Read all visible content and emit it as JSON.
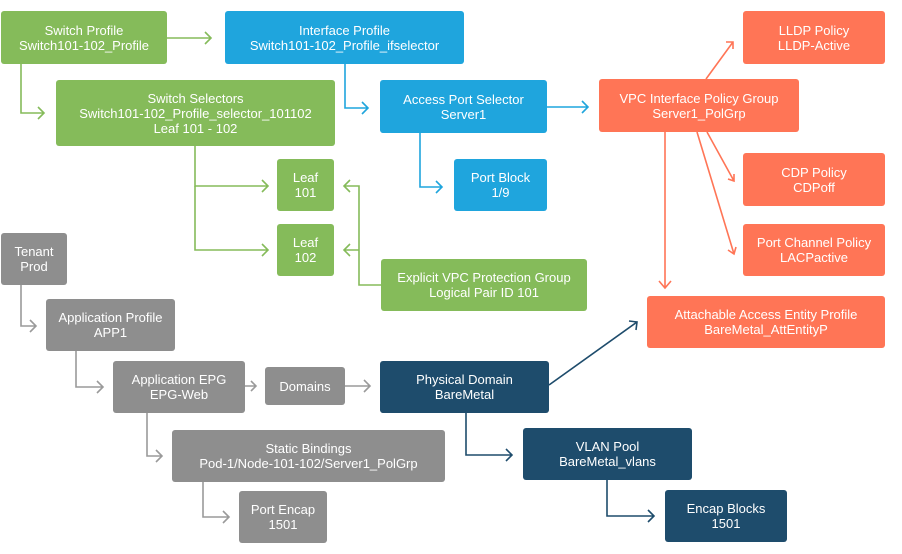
{
  "colors": {
    "switch": "#85bb5a",
    "interface": "#1fa5dd",
    "policy": "#ff7556",
    "tenant": "#8e8e8e",
    "domain": "#1e4c6c"
  },
  "nodes": {
    "switch_profile": [
      "Switch Profile",
      "Switch101-102_Profile"
    ],
    "interface_profile": [
      "Interface Profile",
      "Switch101-102_Profile_ifselector"
    ],
    "switch_selectors": [
      "Switch Selectors",
      "Switch101-102_Profile_selector_101102",
      "Leaf 101 - 102"
    ],
    "access_port_selector": [
      "Access Port Selector",
      "Server1"
    ],
    "vpc_ipg": [
      "VPC Interface Policy Group",
      "Server1_PolGrp"
    ],
    "lldp": [
      "LLDP Policy",
      "LLDP-Active"
    ],
    "port_block": [
      "Port Block",
      "1/9"
    ],
    "leaf101": [
      "Leaf",
      "101"
    ],
    "leaf102": [
      "Leaf",
      "102"
    ],
    "explicit_vpc": [
      "Explicit VPC Protection Group",
      "Logical Pair ID 101"
    ],
    "cdp": [
      "CDP Policy",
      "CDPoff"
    ],
    "port_channel": [
      "Port Channel Policy",
      "LACPactive"
    ],
    "aaep": [
      "Attachable Access Entity Profile",
      "BareMetal_AttEntityP"
    ],
    "tenant": [
      "Tenant",
      "Prod"
    ],
    "app_profile": [
      "Application Profile",
      "APP1"
    ],
    "app_epg": [
      "Application EPG",
      "EPG-Web"
    ],
    "domains": [
      "Domains"
    ],
    "physical_domain": [
      "Physical Domain",
      "BareMetal"
    ],
    "static_bindings": [
      "Static Bindings",
      "Pod-1/Node-101-102/Server1_PolGrp"
    ],
    "vlan_pool": [
      "VLAN Pool",
      "BareMetal_vlans"
    ],
    "port_encap": [
      "Port Encap",
      "1501"
    ],
    "encap_blocks": [
      "Encap Blocks",
      "1501"
    ]
  }
}
